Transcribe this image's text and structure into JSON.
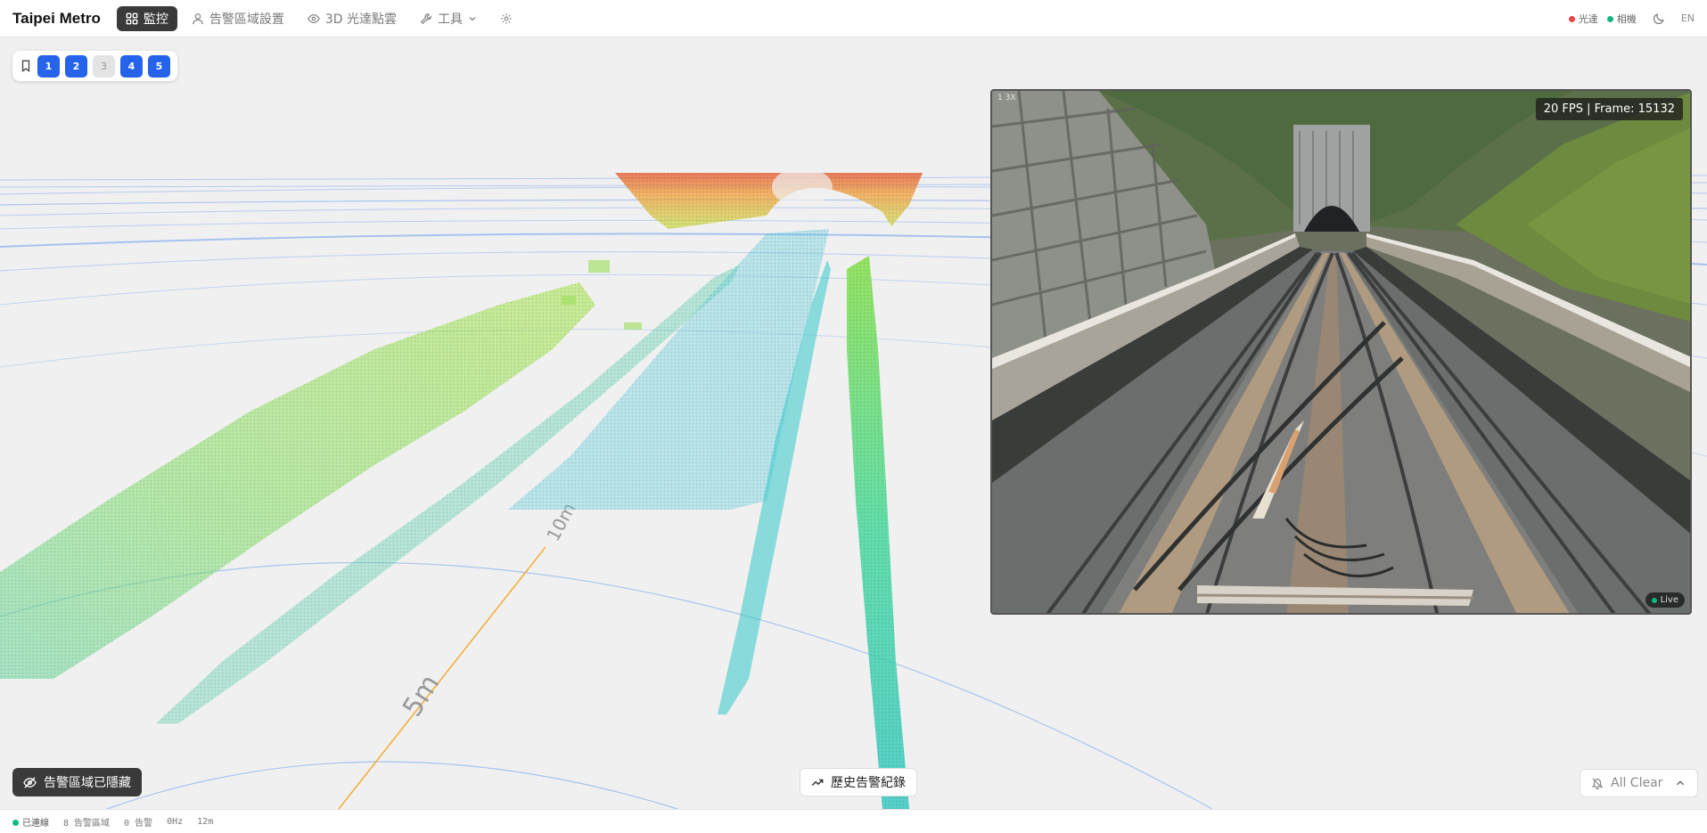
{
  "app": {
    "title": "Taipei Metro"
  },
  "nav": {
    "monitor": "監控",
    "alert_zone_settings": "告警區域設置",
    "lidar_3d": "3D 光達點雲",
    "tools": "工具"
  },
  "header_status": {
    "lidar": "光達",
    "camera": "相機",
    "lang": "EN"
  },
  "presets": [
    "1",
    "2",
    "3",
    "4",
    "5"
  ],
  "active_presets": [
    "1",
    "2",
    "4",
    "5"
  ],
  "scene": {
    "distance_labels": [
      "5m",
      "10m"
    ]
  },
  "camera": {
    "fps_text": "20 FPS | Frame: 15132",
    "timestamp": "1 3X",
    "live": "Live"
  },
  "controls": {
    "hide_zones": "告警區域已隱藏",
    "history": "歷史告警紀錄",
    "all_clear": "All Clear"
  },
  "footer": {
    "connection": "已連線",
    "zones": "8 告警區域",
    "alerts": "0 告警",
    "rate": "0Hz",
    "range": "12m"
  },
  "colors": {
    "accent_blue": "#2563eb",
    "active_nav": "#3a3a3a",
    "status_red": "#ef4444",
    "status_green": "#10b981",
    "axis_orange": "#f5a623"
  }
}
